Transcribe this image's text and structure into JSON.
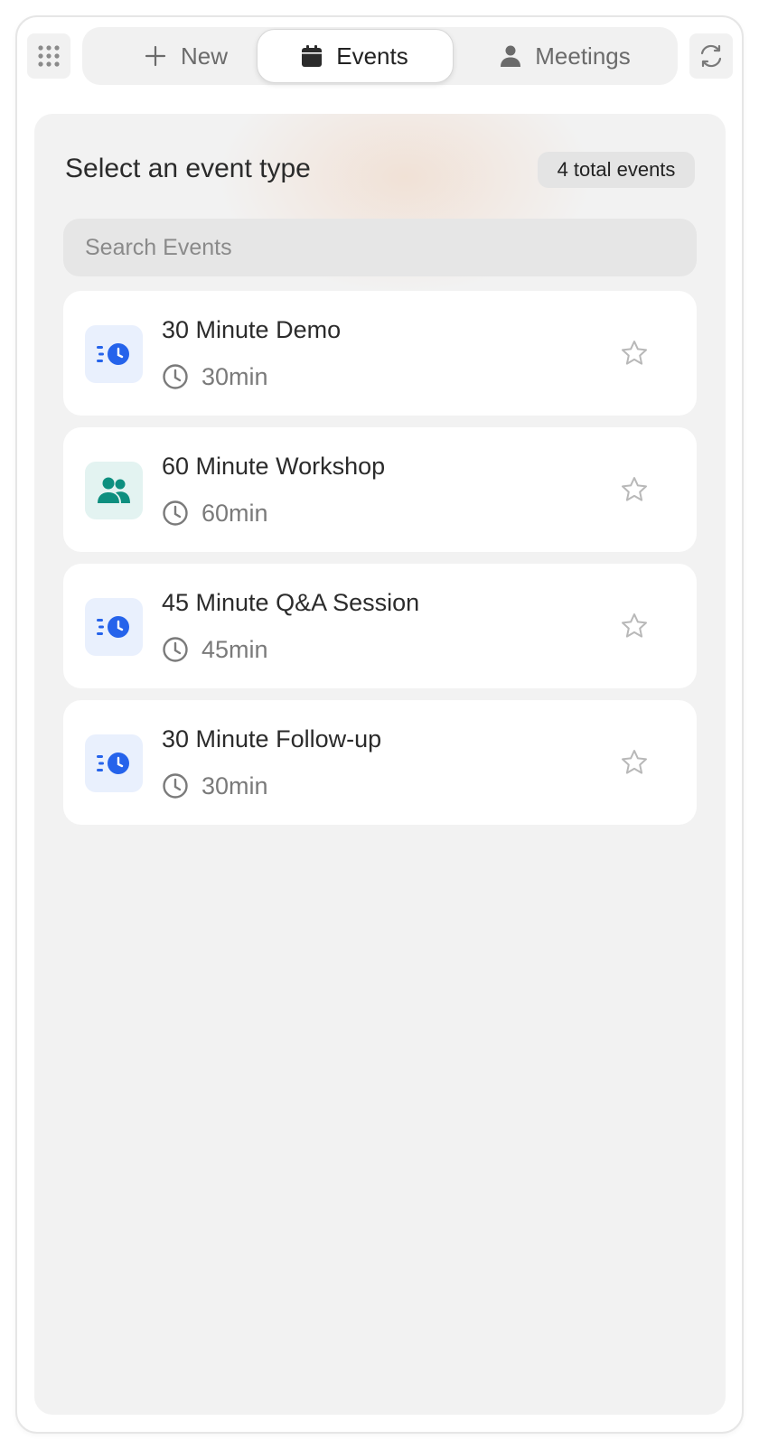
{
  "toolbar": {
    "grid_icon": "apps-grid-icon",
    "tabs": [
      {
        "label": "New",
        "icon": "plus-icon",
        "active": false
      },
      {
        "label": "Events",
        "icon": "calendar-icon",
        "active": true
      },
      {
        "label": "Meetings",
        "icon": "person-icon",
        "active": false
      }
    ],
    "refresh_icon": "refresh-icon"
  },
  "panel": {
    "title": "Select an event type",
    "count_badge": "4 total events",
    "search_placeholder": "Search Events"
  },
  "events": [
    {
      "name": "30 Minute Demo",
      "duration": "30min",
      "icon": "fast-clock-icon",
      "icon_color": "#2563eb",
      "starred": false
    },
    {
      "name": "60 Minute Workshop",
      "duration": "60min",
      "icon": "group-icon",
      "icon_color": "#0d8f7f",
      "starred": false
    },
    {
      "name": "45 Minute Q&A Session",
      "duration": "45min",
      "icon": "fast-clock-icon",
      "icon_color": "#2563eb",
      "starred": false
    },
    {
      "name": "30 Minute Follow-up",
      "duration": "30min",
      "icon": "fast-clock-icon",
      "icon_color": "#2563eb",
      "starred": false
    }
  ],
  "colors": {
    "accent_blue": "#2563eb",
    "accent_teal": "#0d8f7f",
    "panel_bg": "#f2f2f2"
  }
}
